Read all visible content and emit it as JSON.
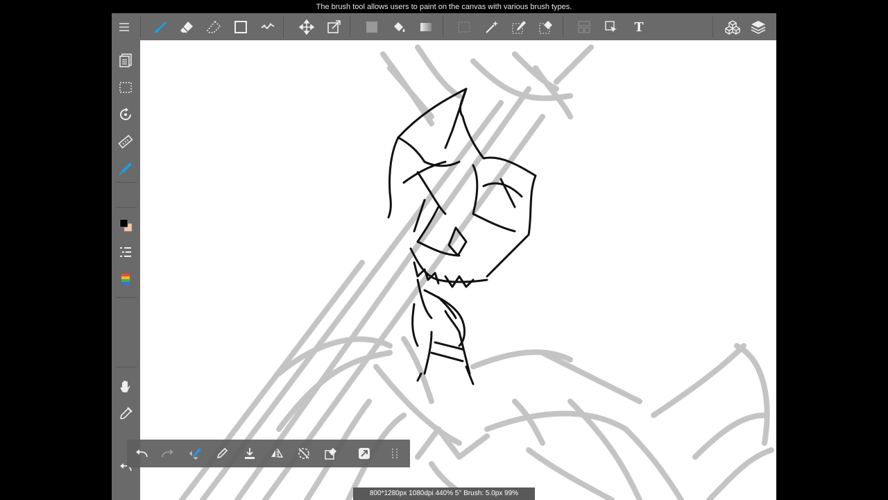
{
  "caption": "The brush tool allows users to paint on the canvas with various brush types.",
  "toolbar": {
    "tools": [
      "menu-icon",
      "brush-icon",
      "eraser-icon",
      "blur-eraser-icon",
      "shape-icon",
      "correction-icon",
      "move-icon",
      "transform-icon",
      "fill-color-icon",
      "bucket-icon",
      "gradient-icon",
      "select-icon",
      "magic-wand-icon",
      "select-pen-icon",
      "select-eraser-icon",
      "layout-icon",
      "select-arrow-icon",
      "text-icon",
      "materials-icon",
      "layers-icon"
    ],
    "text_tool_label": "T"
  },
  "sidebar": {
    "tools": [
      "pages-icon",
      "selection-icon",
      "rotate-icon",
      "ruler-icon",
      "pen-icon",
      "color-swatch",
      "brush-list-icon",
      "palette-icon",
      "hand-icon",
      "eyedropper-icon",
      "undo-arrow-icon"
    ]
  },
  "colors": {
    "accent": "#1e9be0",
    "toolbar_bg": "#6a6a6a",
    "foreground": "#000000",
    "background_color": "#f6c6a7",
    "sketch": "#c4c4c4"
  },
  "bottom_bar": {
    "tools": [
      "undo-icon",
      "redo-icon",
      "brush-drag-icon",
      "pen-icon",
      "save-layer-icon",
      "flip-icon",
      "rotate-lock-icon",
      "clear-icon",
      "snap-icon",
      "grid-icon"
    ]
  },
  "status": "800*1280px 1080dpi 440% 5° Brush: 5.0px 99%"
}
